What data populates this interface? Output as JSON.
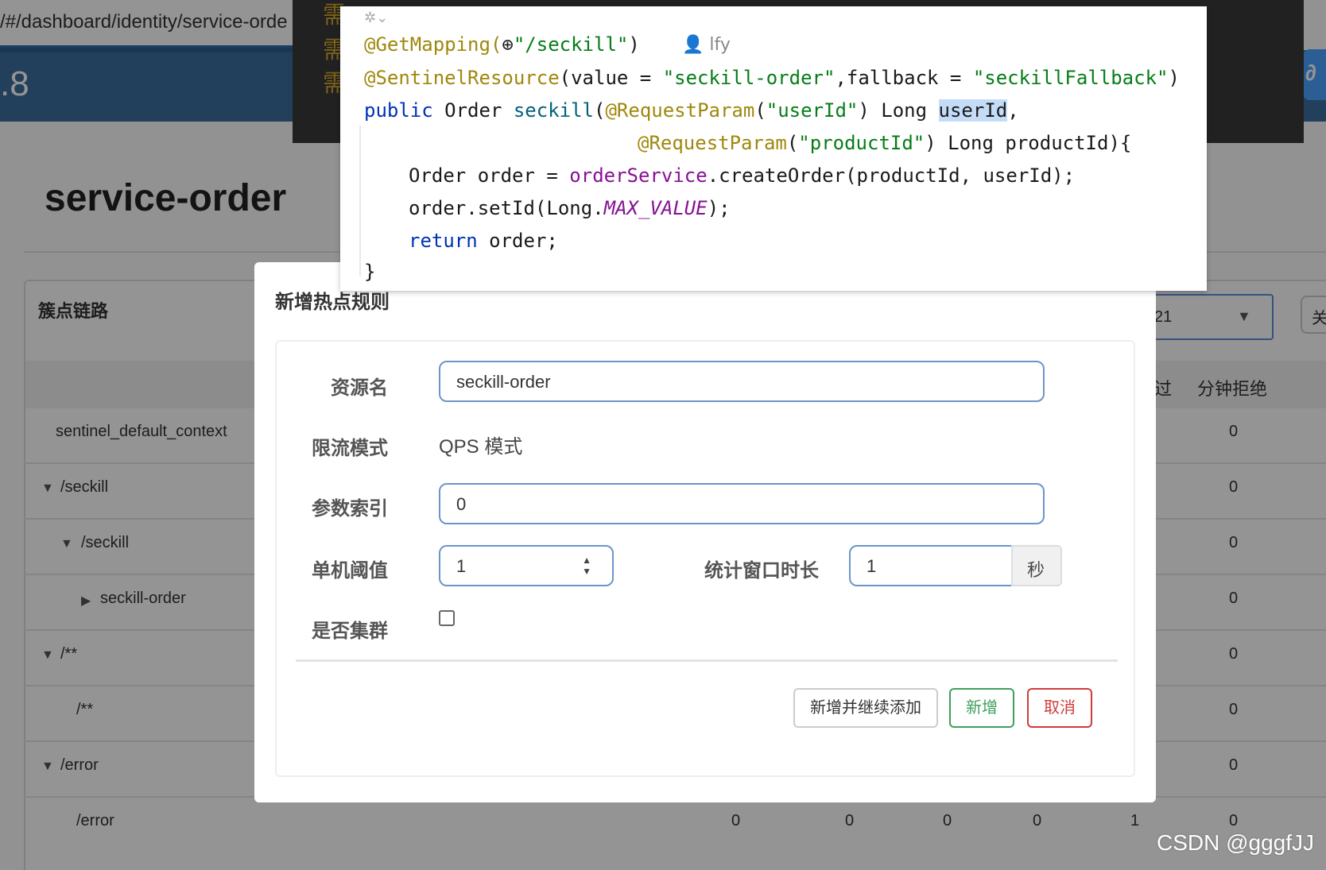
{
  "browser": {
    "url": "/#/dashboard/identity/service-orde",
    "version": ".8"
  },
  "page": {
    "title": "service-order",
    "panel_title": "簇点链路",
    "select_value": "21",
    "right_button_label": "关",
    "columns": [
      "过",
      "分钟拒绝"
    ],
    "rows": [
      {
        "name": "sentinel_default_context",
        "toggle": "",
        "values": [
          "0"
        ]
      },
      {
        "name": "/seckill",
        "toggle": "▼",
        "values": [
          "0"
        ]
      },
      {
        "name": "/seckill",
        "toggle": "▼",
        "values": [
          "0"
        ]
      },
      {
        "name": "seckill-order",
        "toggle": "▶",
        "values": [
          "0"
        ]
      },
      {
        "name": "/**",
        "toggle": "▼",
        "values": [
          "0"
        ]
      },
      {
        "name": "/**",
        "toggle": "",
        "values": [
          "0"
        ]
      },
      {
        "name": "/error",
        "toggle": "▼",
        "values": [
          "0"
        ]
      },
      {
        "name": "/error",
        "toggle": "",
        "values": [
          "0",
          "0",
          "0",
          "0",
          "1",
          "0"
        ]
      }
    ]
  },
  "ide": {
    "comment_chars": [
      "需",
      "需",
      "需"
    ]
  },
  "code": {
    "author": "lfy",
    "line1_ann": "@GetMapping(",
    "line1_globe": "⊕",
    "line1_str": "\"/seckill\"",
    "line1_close": ")",
    "line2_ann": "@SentinelResource",
    "line2_a": "(value = ",
    "line2_s1": "\"seckill-order\"",
    "line2_b": ",fallback = ",
    "line2_s2": "\"seckillFallback\"",
    "line2_c": ")",
    "line3_kw": "public",
    "line3_a": " Order ",
    "line3_fn": "seckill",
    "line3_b": "(",
    "line3_ann": "@RequestParam",
    "line3_c": "(",
    "line3_s": "\"userId\"",
    "line3_d": ") Long ",
    "line3_hl": "userId",
    "line3_e": ",",
    "line4_ann": "@RequestParam",
    "line4_a": "(",
    "line4_s": "\"productId\"",
    "line4_b": ") Long productId){",
    "line5_a": "Order order = ",
    "line5_fld": "orderService",
    "line5_b": ".createOrder(productId, userId);",
    "line6_a": "order.setId(Long.",
    "line6_it": "MAX_VALUE",
    "line6_b": ");",
    "line7_kw": "return",
    "line7_a": " order;",
    "line8": "}"
  },
  "modal": {
    "title": "新增热点规则",
    "resource_label": "资源名",
    "resource_value": "seckill-order",
    "mode_label": "限流模式",
    "mode_value": "QPS 模式",
    "param_index_label": "参数索引",
    "param_index_value": "0",
    "threshold_label": "单机阈值",
    "threshold_value": "1",
    "window_label": "统计窗口时长",
    "window_value": "1",
    "window_unit": "秒",
    "cluster_label": "是否集群",
    "cluster_checked": false,
    "btn_add_continue": "新增并继续添加",
    "btn_add": "新增",
    "btn_cancel": "取消"
  },
  "watermark": "CSDN @gggfJJ"
}
